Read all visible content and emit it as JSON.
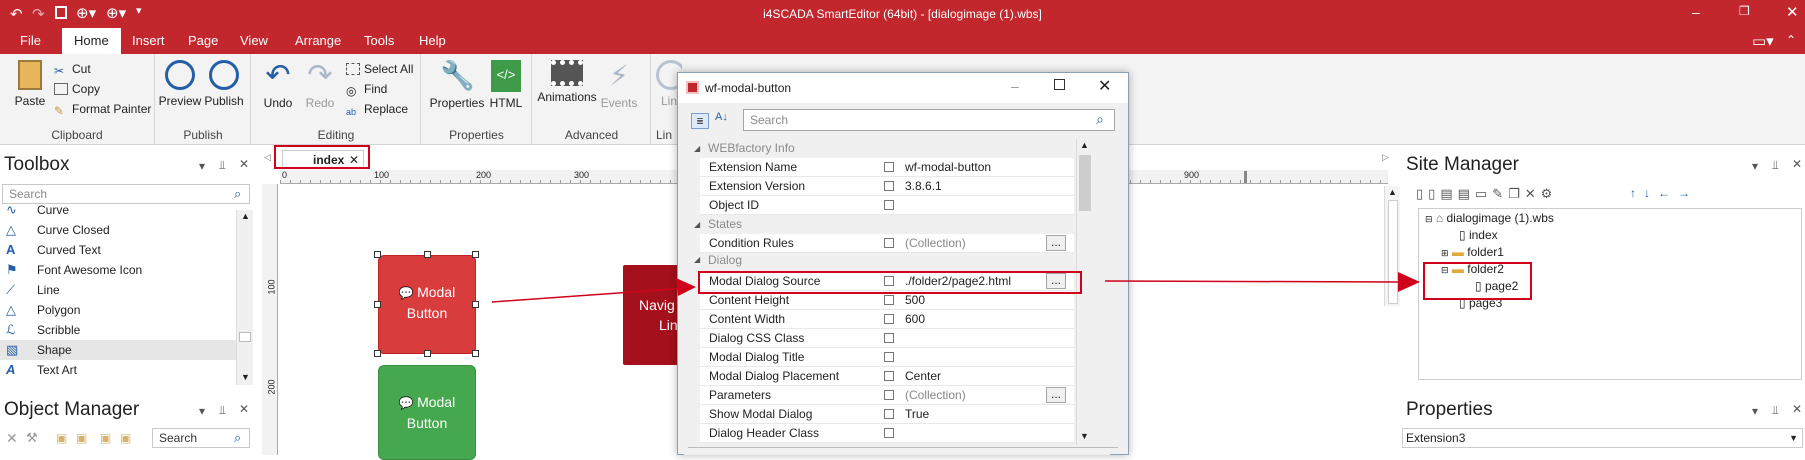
{
  "app": {
    "title": "i4SCADA SmartEditor (64bit) - [dialogimage (1).wbs]"
  },
  "menu": [
    "File",
    "Home",
    "Insert",
    "Page",
    "View",
    "Arrange",
    "Tools",
    "Help"
  ],
  "ribbon": {
    "clipboard": {
      "name": "Clipboard",
      "paste": "Paste",
      "cut": "Cut",
      "copy": "Copy",
      "format_painter": "Format Painter"
    },
    "publish": {
      "name": "Publish",
      "preview": "Preview",
      "publish": "Publish"
    },
    "editing": {
      "name": "Editing",
      "undo": "Undo",
      "redo": "Redo",
      "select_all": "Select All",
      "find": "Find",
      "replace": "Replace"
    },
    "properties": {
      "name": "Properties",
      "properties": "Properties",
      "html": "HTML"
    },
    "advanced": {
      "name": "Advanced",
      "animations": "Animations",
      "events": "Events"
    },
    "links": {
      "name": "Lin",
      "link": "Lin"
    }
  },
  "toolbox": {
    "title": "Toolbox",
    "search_placeholder": "Search",
    "items": [
      {
        "label": "Curve",
        "icon": "curve-icon"
      },
      {
        "label": "Curve Closed",
        "icon": "curve-closed-icon"
      },
      {
        "label": "Curved Text",
        "icon": "curved-text-icon"
      },
      {
        "label": "Font Awesome Icon",
        "icon": "flag-icon"
      },
      {
        "label": "Line",
        "icon": "line-icon"
      },
      {
        "label": "Polygon",
        "icon": "polygon-icon"
      },
      {
        "label": "Scribble",
        "icon": "scribble-icon"
      },
      {
        "label": "Shape",
        "icon": "shape-icon"
      },
      {
        "label": "Text Art",
        "icon": "text-art-icon"
      }
    ]
  },
  "object_manager": {
    "title": "Object Manager",
    "search_placeholder": "Search"
  },
  "document": {
    "tab": "index"
  },
  "ruler": {
    "top": [
      "0",
      "100",
      "200",
      "300",
      "900"
    ],
    "left": [
      "100",
      "200"
    ]
  },
  "canvas": {
    "shape1": {
      "text1": "Modal",
      "text2": "Button",
      "color": "#d93c3c"
    },
    "shape2": {
      "text1": "Navig",
      "text2": "Lin",
      "color": "#a4101b"
    },
    "shape3": {
      "text1": "Modal",
      "text2": "Button",
      "color": "#46a84e"
    }
  },
  "dialog": {
    "title": "wf-modal-button",
    "search_placeholder": "Search",
    "categories": {
      "info": "WEBfactory Info",
      "states": "States",
      "dialog": "Dialog"
    },
    "rows": [
      {
        "name": "Extension Name",
        "value": "wf-modal-button"
      },
      {
        "name": "Extension Version",
        "value": "3.8.6.1"
      },
      {
        "name": "Object ID",
        "value": ""
      },
      {
        "name": "Condition Rules",
        "value": "(Collection)"
      },
      {
        "name": "Modal Dialog Source",
        "value": "./folder2/page2.html"
      },
      {
        "name": "Content Height",
        "value": "500"
      },
      {
        "name": "Content Width",
        "value": "600"
      },
      {
        "name": "Dialog CSS Class",
        "value": ""
      },
      {
        "name": "Modal Dialog Title",
        "value": ""
      },
      {
        "name": "Modal Dialog Placement",
        "value": "Center"
      },
      {
        "name": "Parameters",
        "value": "(Collection)"
      },
      {
        "name": "Show Modal Dialog",
        "value": "True"
      },
      {
        "name": "Dialog Header Class",
        "value": ""
      }
    ],
    "ellipsis": "..."
  },
  "site_manager": {
    "title": "Site Manager",
    "tree": {
      "root": "dialogimage (1).wbs",
      "index": "index",
      "folder1": "folder1",
      "folder2": "folder2",
      "page2": "page2",
      "page3": "page3"
    }
  },
  "properties_panel": {
    "title": "Properties",
    "selected": "Extension3"
  },
  "accent": "#c1272d",
  "highlight": "#d0021b"
}
